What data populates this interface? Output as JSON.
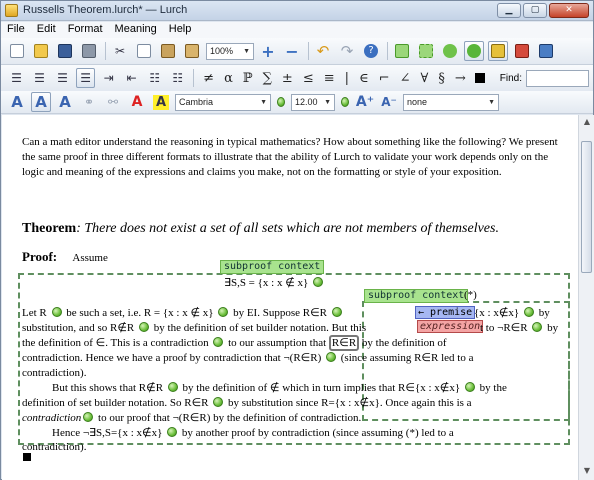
{
  "window": {
    "title": "Russells Theorem.lurch* — Lurch"
  },
  "menubar": {
    "items": [
      "File",
      "Edit",
      "Format",
      "Meaning",
      "Help"
    ]
  },
  "toolbar1": {
    "zoom": "100%",
    "buttons": [
      "new",
      "open",
      "save",
      "print",
      "cut",
      "copy",
      "paste",
      "paste-special",
      "zoom-in",
      "zoom-out",
      "undo",
      "redo",
      "help",
      "bubble-1",
      "bubble-2",
      "bubble-3",
      "bubble-4",
      "lock",
      "cancel",
      "info"
    ]
  },
  "toolbar2": {
    "symbols": [
      "≠",
      "α",
      "ℙ",
      "∑",
      "±",
      "≤",
      "≡",
      "|",
      "∈",
      "⌐",
      "∠",
      "∀",
      "§",
      "→"
    ],
    "find_label": "Find:"
  },
  "toolbar3": {
    "font": "Cambria",
    "size": "12.00",
    "style": "none"
  },
  "document": {
    "intro": "Can a math editor understand the reasoning in typical mathematics?  How about something like the following? We present the same proof in three different formats to illustrate that the ability of Lurch to validate your work depends only on the logic and meaning of the expressions and claims you make, not on the formatting or style of your exposition.",
    "theorem_label": "Theorem",
    "theorem_text": ": There does not exist a set of all sets which are not members of themselves.",
    "proof_label": "Proof:",
    "proof_assume": "Assume",
    "bubble_subproof1": "subproof context",
    "bubble_subproof2": "subproof context",
    "assume_formula": "∃S,S = {x : x ∉ x}",
    "star": "(*)",
    "line1": "Let R ",
    "line1b": " be such a set, i.e. R = {x : x ∉ x} ",
    "line1c": " by EI. Suppose R∈R ",
    "premise_tag": "← premise",
    "premise_formula": "{x : x∉x}",
    "line2": "substitution, and so R∉R ",
    "line2b": " by the definition of set builder notation. But this",
    "expression_tag": "expression",
    "line2c": "t to ¬R∈R ",
    "line2d": " by",
    "line3": "the definition of ∈. This is a contradiction ",
    "line3b": " to our assumption that",
    "line3c": "R∈R",
    "line3d": " by the definition of",
    "line4": "contradiction. Hence we have a proof by contradiction that ¬(R∈R) ",
    "line4b": " (since assuming R∈R led to a",
    "line5": "contradiction).",
    "line6": "But this shows that R∉R ",
    "line6b": " by the definition of ∉ which in turn implies that R∈{x : x∉x} ",
    "line6c": " by the",
    "line7": "definition of set builder notation. So R∈R ",
    "line7b": " by substitution since R={x : x∉x}. Once again this is a",
    "line8a": "contradiction",
    "line8": " to our proof that ¬(R∈R) by the definition of contradiction.",
    "line9": "Hence ¬∃S,S={x : x∉x} ",
    "line9b": " by another proof by contradiction (since assuming (*) led to a",
    "line10": "contradiction)."
  },
  "colors": {
    "bubble_green": "#a8e38e",
    "premise_blue": "#a6b7f2",
    "expression_red": "#f4a4a4"
  }
}
